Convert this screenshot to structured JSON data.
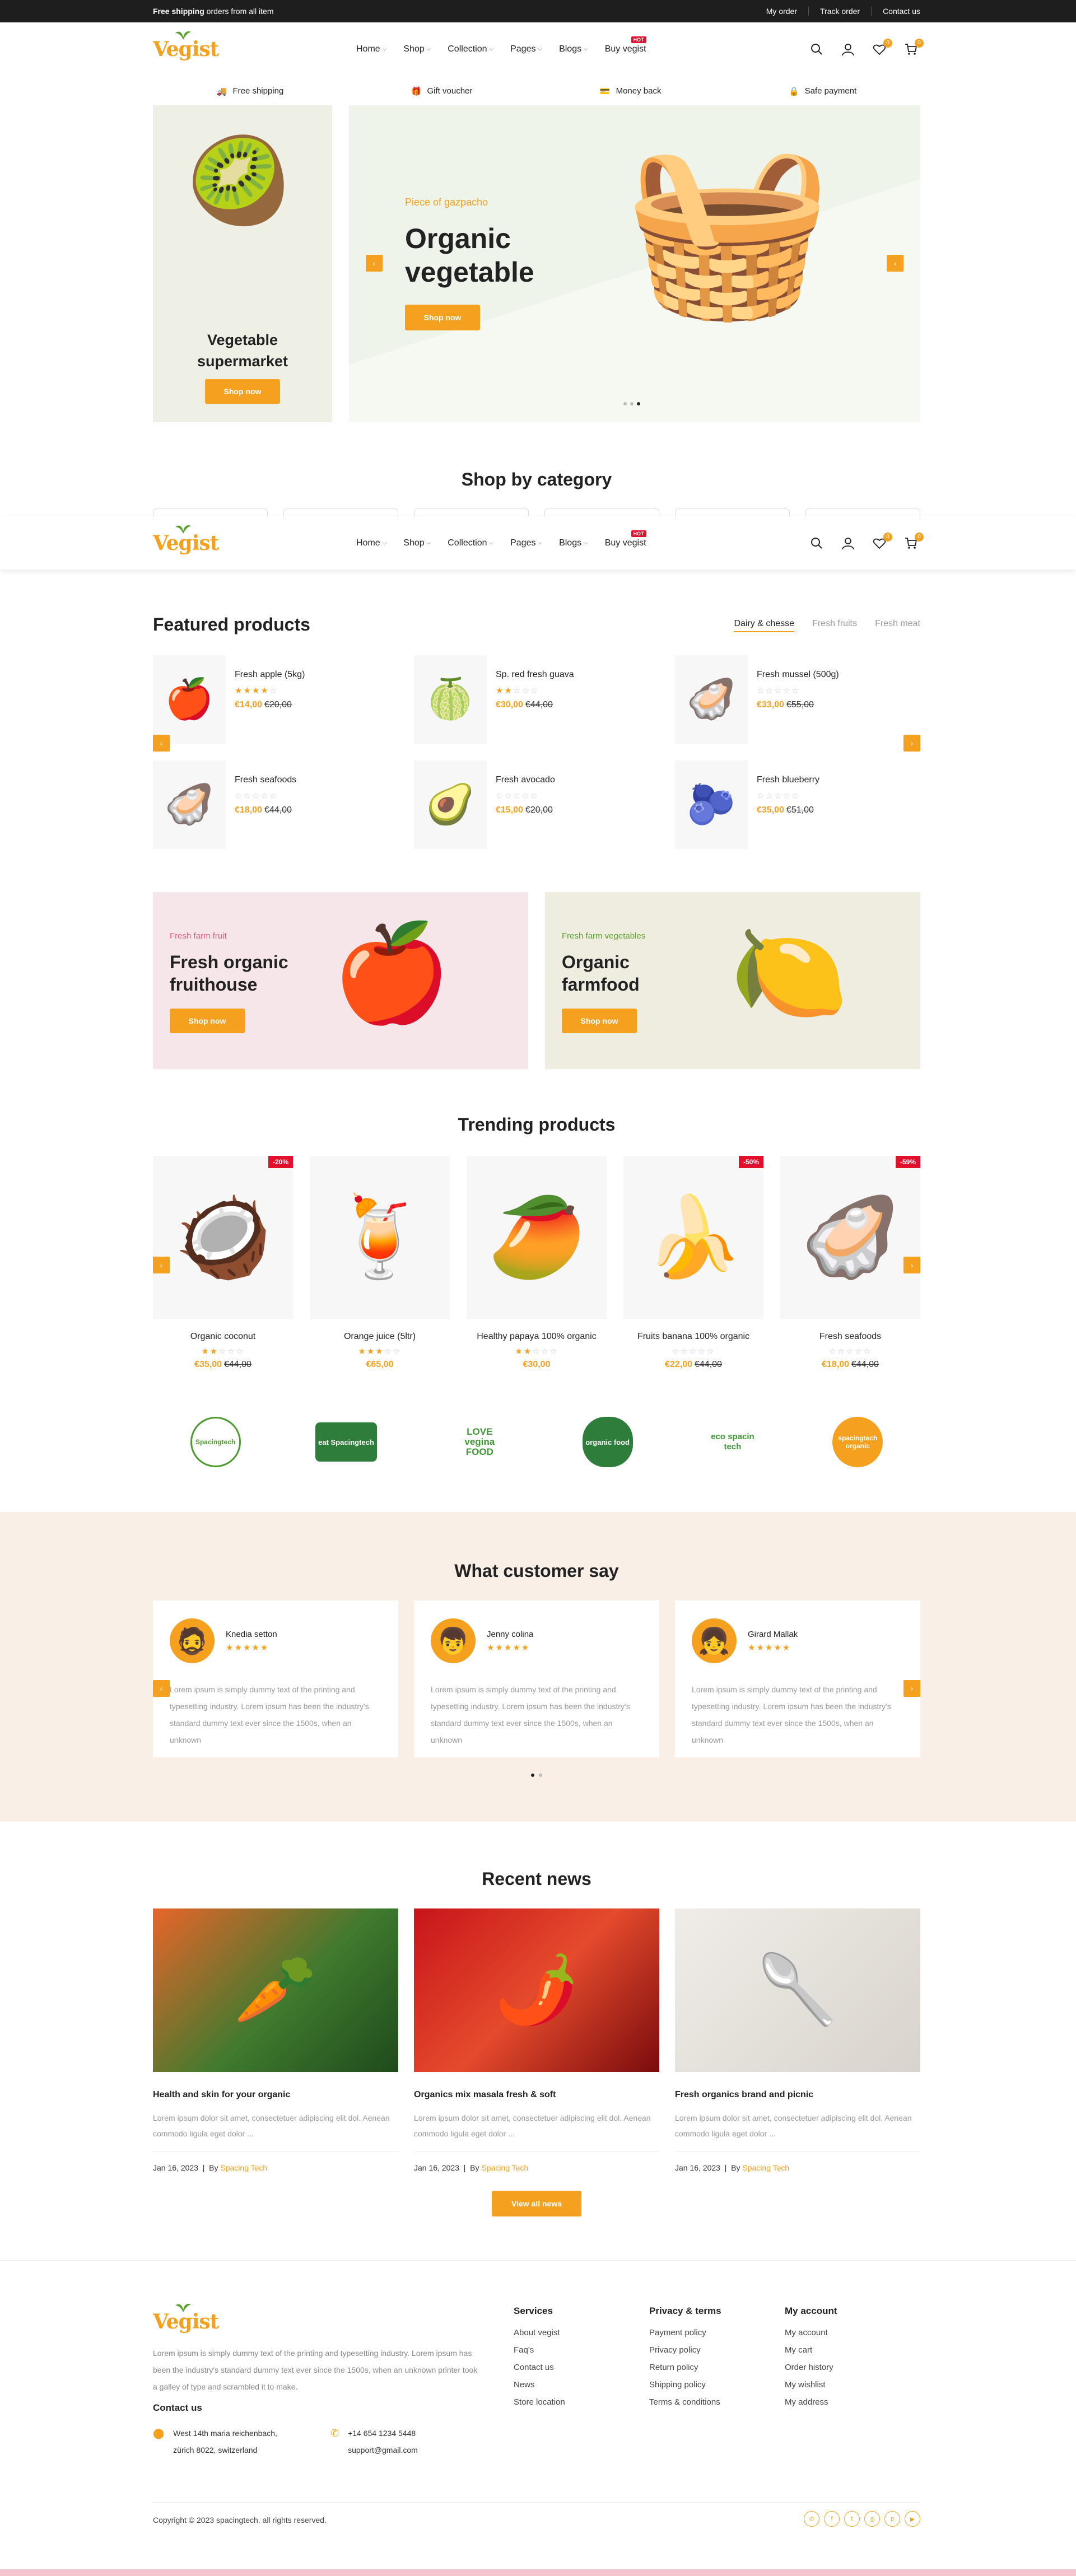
{
  "topbar": {
    "promo_bold": "Free shipping",
    "promo_rest": " orders from all item",
    "links": [
      "My order",
      "Track order",
      "Contact us"
    ]
  },
  "logo": "Vegist",
  "nav": [
    {
      "label": "Home",
      "chev": true
    },
    {
      "label": "Shop",
      "chev": true
    },
    {
      "label": "Collection",
      "chev": true
    },
    {
      "label": "Pages",
      "chev": true
    },
    {
      "label": "Blogs",
      "chev": true
    },
    {
      "label": "Buy vegist",
      "chev": false,
      "hot": "HOT"
    }
  ],
  "header_badges": {
    "wishlist": "0",
    "cart": "0"
  },
  "services": [
    "Free shipping",
    "Gift voucher",
    "Money back",
    "Safe payment"
  ],
  "left_banner": {
    "title": "Vegetable supermarket",
    "button": "Shop now"
  },
  "hero": {
    "kicker": "Piece of gazpacho",
    "title": "Organic vegetable",
    "button": "Shop now"
  },
  "shop_by_category": "Shop by category",
  "featured": {
    "title": "Featured products",
    "tabs": [
      "Dairy & chesse",
      "Fresh fruits",
      "Fresh meat"
    ],
    "products": [
      {
        "name": "Fresh apple (5kg)",
        "rating": 4,
        "price": "€14,00",
        "old": "€20,00",
        "emoji": "🍎"
      },
      {
        "name": "Sp. red fresh guava",
        "rating": 2,
        "price": "€30,00",
        "old": "€44,00",
        "emoji": "🍈"
      },
      {
        "name": "Fresh mussel (500g)",
        "rating": 0,
        "price": "€33,00",
        "old": "€55,00",
        "emoji": "🦪"
      },
      {
        "name": "Fresh seafoods",
        "rating": 0,
        "price": "€18,00",
        "old": "€44,00",
        "emoji": "🦪"
      },
      {
        "name": "Fresh avocado",
        "rating": 0,
        "price": "€15,00",
        "old": "€20,00",
        "emoji": "🥑"
      },
      {
        "name": "Fresh blueberry",
        "rating": 0,
        "price": "€35,00",
        "old": "€51,00",
        "emoji": "🫐"
      }
    ]
  },
  "promo_banners": [
    {
      "kicker": "Fresh farm fruit",
      "title": "Fresh organic fruithouse",
      "button": "Shop now",
      "emoji": "🍎"
    },
    {
      "kicker": "Fresh farm vegetables",
      "title": "Organic farmfood",
      "button": "Shop now",
      "emoji": "🍋"
    }
  ],
  "trending": {
    "title": "Trending products",
    "products": [
      {
        "name": "Organic coconut",
        "rating": 2,
        "price": "€35,00",
        "old": "€44,00",
        "sale": "-20%",
        "emoji": "🥥"
      },
      {
        "name": "Orange juice (5ltr)",
        "rating": 3,
        "price": "€65,00",
        "old": "",
        "sale": "",
        "emoji": "🍹"
      },
      {
        "name": "Healthy papaya 100% organic",
        "rating": 2,
        "price": "€30,00",
        "old": "",
        "sale": "",
        "emoji": "🥭"
      },
      {
        "name": "Fruits banana 100% organic",
        "rating": 0,
        "price": "€22,00",
        "old": "€44,00",
        "sale": "-50%",
        "emoji": "🍌"
      },
      {
        "name": "Fresh seafoods",
        "rating": 0,
        "price": "€18,00",
        "old": "€44,00",
        "sale": "-59%",
        "emoji": "🦪"
      }
    ]
  },
  "brands": [
    "Spacingtech",
    "eat Spacingtech",
    "LOVE vegina FOOD",
    "organic food",
    "eco spacin tech",
    "spacingtech organic"
  ],
  "testimonials": {
    "title": "What customer say",
    "items": [
      {
        "name": "Knedia setton",
        "text": "Lorem ipsum is simply dummy text of the printing and typesetting industry. Lorem ipsum has been the industry's standard dummy text ever since the 1500s, when an unknown"
      },
      {
        "name": "Jenny colina",
        "text": "Lorem ipsum is simply dummy text of the printing and typesetting industry. Lorem ipsum has been the industry's standard dummy text ever since the 1500s, when an unknown"
      },
      {
        "name": "Girard Mallak",
        "text": "Lorem ipsum is simply dummy text of the printing and typesetting industry. Lorem ipsum has been the industry's standard dummy text ever since the 1500s, when an unknown"
      }
    ]
  },
  "news": {
    "title": "Recent news",
    "items": [
      {
        "title": "Health and skin for your organic",
        "excerpt": "Lorem ipsum dolor sit amet, consectetuer adipiscing elit dol. Aenean commodo ligula eget dolor ...",
        "date": "Jan 16, 2023",
        "by": "By",
        "author": "Spacing Tech"
      },
      {
        "title": "Organics mix masala fresh & soft",
        "excerpt": "Lorem ipsum dolor sit amet, consectetuer adipiscing elit dol. Aenean commodo ligula eget dolor ...",
        "date": "Jan 16, 2023",
        "by": "By",
        "author": "Spacing Tech"
      },
      {
        "title": "Fresh organics brand and picnic",
        "excerpt": "Lorem ipsum dolor sit amet, consectetuer adipiscing elit dol. Aenean commodo ligula eget dolor ...",
        "date": "Jan 16, 2023",
        "by": "By",
        "author": "Spacing Tech"
      }
    ],
    "button": "View all news"
  },
  "footer": {
    "about": "Lorem ipsum is simply dummy text of the printing and typesetting industry. Lorem ipsum has been the industry's standard dummy text ever since the 1500s, when an unknown printer took a galley of type and scrambled it to make.",
    "contact_title": "Contact us",
    "address_line1": "West 14th maria reichenbach,",
    "address_line2": "zürich 8022, switzerland",
    "phone": "+14 654 1234 5448",
    "email": "support@gmail.com",
    "columns": [
      {
        "title": "Services",
        "links": [
          "About vegist",
          "Faq's",
          "Contact us",
          "News",
          "Store location"
        ]
      },
      {
        "title": "Privacy & terms",
        "links": [
          "Payment policy",
          "Privacy policy",
          "Return policy",
          "Shipping policy",
          "Terms & conditions"
        ]
      },
      {
        "title": "My account",
        "links": [
          "My account",
          "My cart",
          "Order history",
          "My wishlist",
          "My address"
        ]
      }
    ],
    "copyright": "Copyright © 2023 spacingtech. all rights reserved.",
    "socials": [
      "whatsapp-icon",
      "facebook-icon",
      "twitter-icon",
      "instagram-icon",
      "pinterest-icon",
      "youtube-icon"
    ]
  },
  "colors": {
    "accent": "#f5a11f",
    "hot": "#e3102c",
    "testimonial_bg": "#f9efe6"
  }
}
